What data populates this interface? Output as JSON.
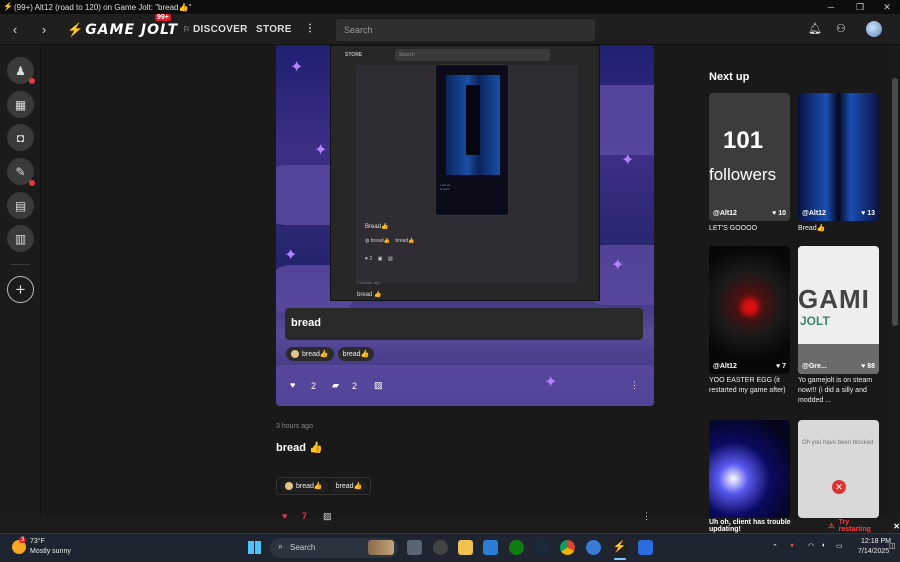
{
  "window": {
    "title": "(99+) Alt12 (road to 120) on Game Jolt: \"bread👍\"",
    "controls": {
      "minimize": "─",
      "maximize": "❐",
      "close": "✕"
    }
  },
  "topnav": {
    "back": "‹",
    "forward": "›",
    "logo": "GAME JOLT",
    "notif_badge": "99+",
    "discover": "DISCOVER",
    "store": "STORE",
    "more": "⋮",
    "search_placeholder": "Search"
  },
  "sidebar": {
    "icons": [
      "quests-icon",
      "store-icon",
      "backpack-icon",
      "realm-icon",
      "chat-icon",
      "library-icon"
    ],
    "add": "+"
  },
  "post_card": {
    "inner_nav_store": "STORE",
    "inner_search": "Search",
    "inner_caption": "Bread👍",
    "inner_time": "1 minute ago",
    "inner_footer": "bread 👍",
    "caption": "bread",
    "chips": [
      "bread👍",
      "bread👍"
    ],
    "likes": "2",
    "comments": "2"
  },
  "post": {
    "time": "3 hours ago",
    "text": "bread 👍",
    "chips": [
      "bread👍",
      "bread👍"
    ],
    "likes": "7"
  },
  "next_up": {
    "heading": "Next up",
    "items": [
      {
        "user": "@Alt12",
        "likes": "10",
        "title": "LET'S GOOOO",
        "overlay": "101\nfollowers"
      },
      {
        "user": "@Alt12",
        "likes": "13",
        "title": "Bread👍"
      },
      {
        "user": "@Alt12",
        "likes": "7",
        "title": "YOO EASTER EGG (it restarted my game after)"
      },
      {
        "user": "@Gre...",
        "likes": "88",
        "title": "Yo gamejolt is on steam now!!! (i did a silly and modded ..."
      },
      {
        "user": "",
        "likes": "",
        "title": ""
      },
      {
        "user": "",
        "likes": "",
        "title": "",
        "overlay": "Oh you have been blocked"
      }
    ]
  },
  "toast": {
    "message": "Uh oh, client has trouble updating!",
    "action": "Try restarting",
    "close": "✕"
  },
  "taskbar": {
    "weather_temp": "73°F",
    "weather_desc": "Mostly sunny",
    "weather_badge": "3",
    "search": "Search",
    "time": "12:18 PM",
    "date": "7/14/2025"
  },
  "colors": {
    "accent": "#e8354f",
    "brand_green": "#2f7f6f",
    "toast_warning": "#ff3b3b"
  }
}
